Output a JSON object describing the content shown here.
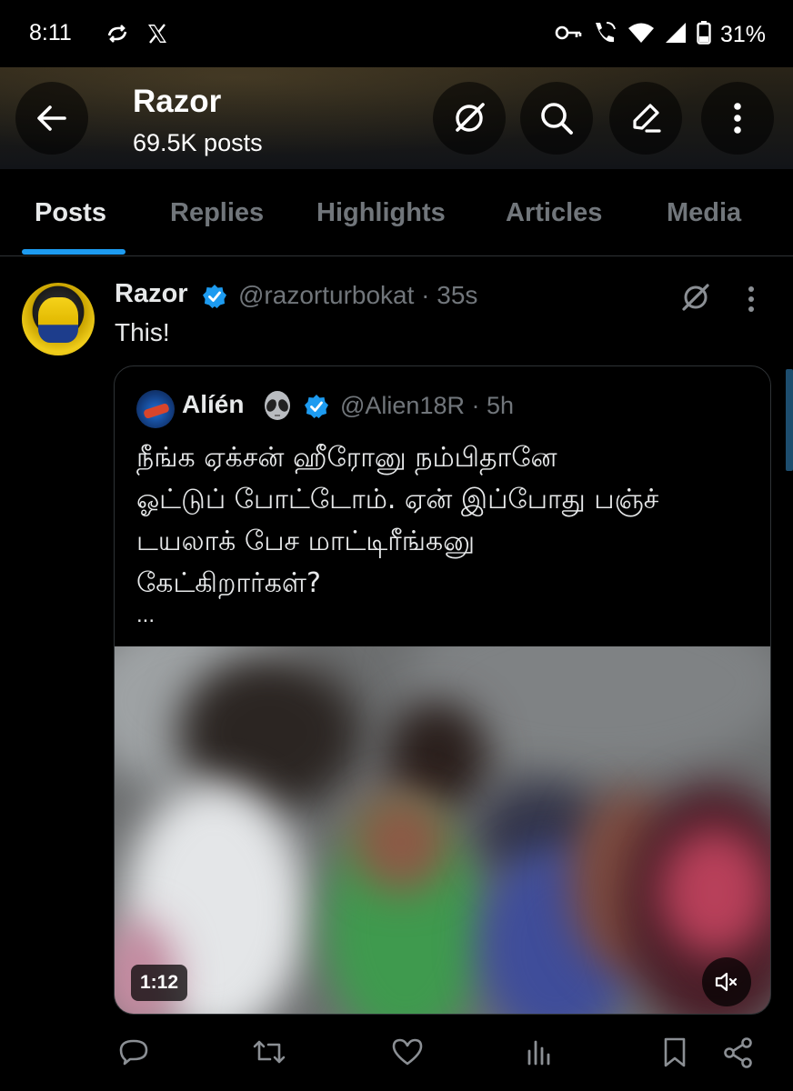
{
  "status_bar": {
    "time": "8:11",
    "battery": "31%",
    "left_icons": [
      "sync-icon",
      "x-logo-icon"
    ],
    "right_icons": [
      "key-icon",
      "wifi-calling-icon",
      "wifi-icon",
      "signal-icon",
      "battery-icon"
    ]
  },
  "header": {
    "title": "Razor",
    "subtitle": "69.5K posts",
    "buttons": [
      "back-button",
      "grok-button",
      "search-button",
      "compose-button",
      "more-button"
    ]
  },
  "tabs": [
    {
      "label": "Posts",
      "active": true
    },
    {
      "label": "Replies",
      "active": false
    },
    {
      "label": "Highlights",
      "active": false
    },
    {
      "label": "Articles",
      "active": false
    },
    {
      "label": "Media",
      "active": false
    }
  ],
  "post": {
    "author_name": "Razor",
    "handle_time": "@razorturbokat · 35s",
    "text": "This!",
    "verified": true
  },
  "quote": {
    "author_name": "Alíén",
    "author_emoji": "👽",
    "handle_time": "@Alien18R · 5h",
    "text": "நீங்க ஏக்சன் ஹீரோனு நம்பிதானே\nஓட்டுப் போட்டோம். ஏன் இப்போது பஞ்ச்\nடயலாக் பேச மாட்டிரீங்கனு\nகேட்கிறார்கள்?",
    "ellipsis": "...",
    "video": {
      "duration": "1:12",
      "muted": true
    }
  },
  "actions": [
    "reply-icon",
    "repost-icon",
    "like-icon",
    "views-icon",
    "bookmark-icon",
    "share-icon"
  ],
  "colors": {
    "accent": "#1d9bf0",
    "muted_text": "#71767b",
    "text": "#e7e9ea",
    "border": "#2f3336"
  }
}
